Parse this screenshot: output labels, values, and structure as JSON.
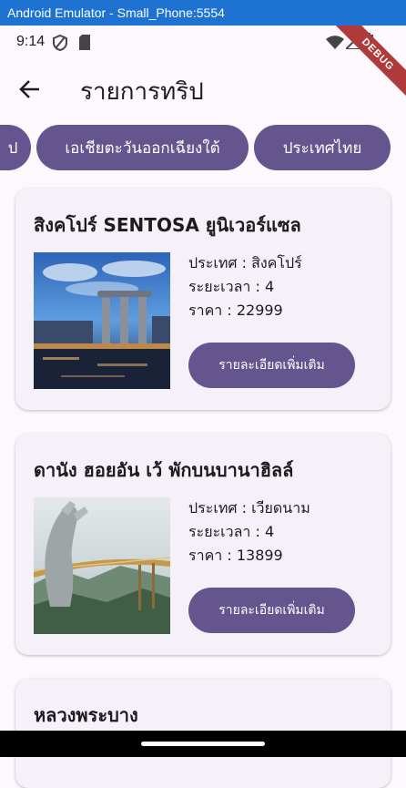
{
  "window": {
    "title": "Android Emulator - Small_Phone:5554"
  },
  "status_bar": {
    "time": "9:14",
    "debug_label": "DEBUG"
  },
  "app_bar": {
    "title": "รายการทริป"
  },
  "chips": [
    {
      "label": "ป"
    },
    {
      "label": "เอเชียตะวันออกเฉียงใต้"
    },
    {
      "label": "ประเทศไทย"
    }
  ],
  "trips": [
    {
      "title": "สิงคโปร์ SENTOSA ยูนิเวอร์แซล",
      "country": "ประเทศ : สิงคโปร์",
      "duration": "ระยะเวลา : 4",
      "price": "ราคา : 22999",
      "button_label": "รายละเอียดเพิ่มเติม"
    },
    {
      "title": "ดานัง ฮอยอัน เว้ พักบนบานาฮิลล์",
      "country": "ประเทศ : เวียดนาม",
      "duration": "ระยะเวลา : 4",
      "price": "ราคา : 13899",
      "button_label": "รายละเอียดเพิ่มเติม"
    },
    {
      "title": "หลวงพระบาง"
    }
  ],
  "colors": {
    "background": "#fdf7fe",
    "primary": "#65558f",
    "card": "#f6f0f9",
    "window_bar": "#1e73d2"
  }
}
